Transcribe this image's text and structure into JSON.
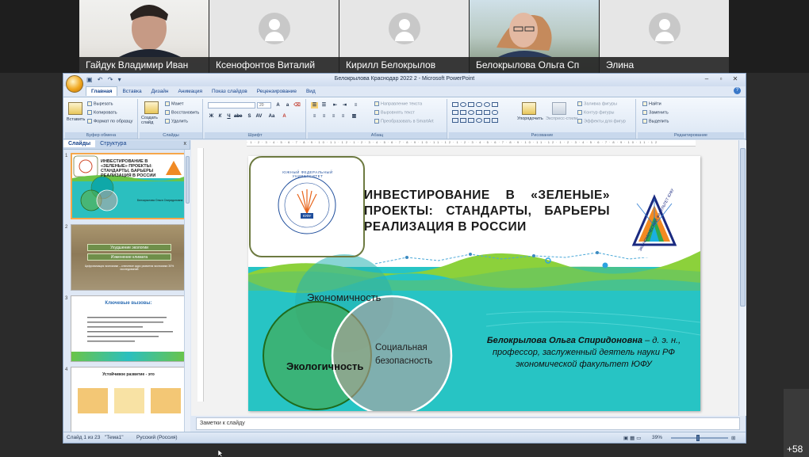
{
  "participants": [
    {
      "name": "Гайдук Владимир Иван",
      "video": "camera"
    },
    {
      "name": "Ксенофонтов Виталий",
      "video": "avatar-placeholder"
    },
    {
      "name": "Кирилл Белокрылов",
      "video": "avatar-placeholder"
    },
    {
      "name": "Белокрылова Ольга Сп",
      "video": "camera"
    },
    {
      "name": "Элина",
      "video": "avatar-placeholder"
    }
  ],
  "overflow_count": "+58",
  "window": {
    "title": "Белокрылова Краснодар 2022  2 - Microsoft PowerPoint",
    "controls": [
      "–",
      "▫",
      "✕"
    ]
  },
  "ribbon_tabs": [
    "Главная",
    "Вставка",
    "Дизайн",
    "Анимация",
    "Показ слайдов",
    "Рецензирование",
    "Вид"
  ],
  "ribbon": {
    "clipboard": {
      "label": "Буфер обмена",
      "paste": "Вставить",
      "cut": "Вырезать",
      "copy": "Копировать",
      "format_painter": "Формат по образцу"
    },
    "slides": {
      "label": "Слайды",
      "create": "Создать слайд",
      "layout": "Макет",
      "restore": "Восстановить",
      "delete": "Удалить"
    },
    "font": {
      "label": "Шрифт",
      "size": "20"
    },
    "paragraph": {
      "label": "Абзац",
      "text_dir": "Направление текста",
      "align_text": "Выровнять текст",
      "smartart": "Преобразовать в SmartArt"
    },
    "drawing": {
      "label": "Рисование",
      "arrange": "Упорядочить",
      "quick_styles": "Экспресс-стили",
      "fill": "Заливка фигуры",
      "outline": "Контур фигуры",
      "effects": "Эффекты для фигур"
    },
    "editing": {
      "label": "Редактирование",
      "find": "Найти",
      "replace": "Заменить",
      "select": "Выделить"
    }
  },
  "left_pane": {
    "tabs": [
      "Слайды",
      "Структура"
    ],
    "close": "x",
    "thumbnails": [
      {
        "num": "1",
        "title": "ИНВЕСТИРОВАНИЕ В «ЗЕЛЕНЫЕ» ПРОЕКТЫ: СТАНДАРТЫ, БАРЬЕРЫ РЕАЛИЗАЦИЯ В РОССИИ"
      },
      {
        "num": "2",
        "boxes": [
          "Ухудшение экологии",
          "Изменение климата"
        ],
        "caption": "Цифровизация экономики – ключевое ядро развития экономики 30% исследований"
      },
      {
        "num": "3",
        "title": "Ключевые вызовы:"
      },
      {
        "num": "4",
        "title": "Устойчивое развитие - это"
      }
    ]
  },
  "slide": {
    "title_lines": [
      "ИНВЕСТИРОВАНИЕ В «ЗЕЛЕНЫЕ»",
      "ПРОЕКТЫ: СТАНДАРТЫ, БАРЬЕРЫ",
      "РЕАЛИЗАЦИЯ В РОССИИ"
    ],
    "logo_left_text": "ЮЖНЫЙ ФЕДЕРАЛЬНЫЙ УНИВЕРСИТЕТ",
    "logo_left_badge": "ЮФУ",
    "logo_right_text": "ЭКОНОМИЧЕСКИЙ ФАКУЛЬТЕТ ЮФУ",
    "venn": {
      "economy": "Экономичность",
      "ecology": "Экологичность",
      "social_line1": "Социальная",
      "social_line2": "безопасность"
    },
    "author_name": "Белокрылова Ольга Спиридоновна",
    "author_rest": " – д. э. н.,",
    "author_line2": "профессор, заслуженный деятель науки РФ",
    "author_line3": "экономической факультет ЮФУ"
  },
  "notes_placeholder": "Заметки к слайду",
  "statusbar": {
    "slide_of": "Слайд 1 из 23",
    "theme": "\"Тема1\"",
    "language": "Русский (Россия)",
    "zoom": "39%"
  },
  "colors": {
    "teal": "#27c4c4",
    "green": "#6bc447",
    "office_blue": "#15428b"
  }
}
